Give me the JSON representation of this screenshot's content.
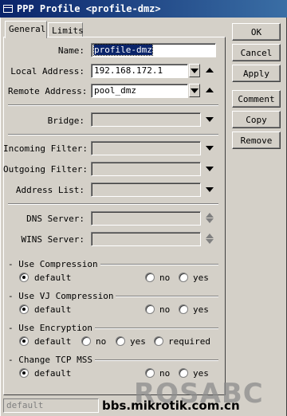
{
  "window": {
    "title": "PPP Profile <profile-dmz>"
  },
  "tabs": [
    {
      "label": "General"
    },
    {
      "label": "Limits"
    }
  ],
  "general": {
    "name": {
      "label": "Name:",
      "value": "profile-dmz"
    },
    "local_address": {
      "label": "Local Address:",
      "value": "192.168.172.1"
    },
    "remote_address": {
      "label": "Remote Address:",
      "value": "pool_dmz"
    },
    "bridge": {
      "label": "Bridge:",
      "value": ""
    },
    "incoming_filter": {
      "label": "Incoming Filter:",
      "value": ""
    },
    "outgoing_filter": {
      "label": "Outgoing Filter:",
      "value": ""
    },
    "address_list": {
      "label": "Address List:",
      "value": ""
    },
    "dns_server": {
      "label": "DNS Server:",
      "value": ""
    },
    "wins_server": {
      "label": "WINS Server:",
      "value": ""
    },
    "use_compression": {
      "label": "Use Compression",
      "options": [
        "default",
        "no",
        "yes"
      ],
      "selected": "default"
    },
    "use_vj_compression": {
      "label": "Use VJ Compression",
      "options": [
        "default",
        "no",
        "yes"
      ],
      "selected": "default"
    },
    "use_encryption": {
      "label": "Use Encryption",
      "options": [
        "default",
        "no",
        "yes",
        "required"
      ],
      "selected": "default"
    },
    "change_tcp_mss": {
      "label": "Change TCP MSS",
      "options": [
        "default",
        "no",
        "yes"
      ],
      "selected": "default"
    }
  },
  "buttons": {
    "ok": "OK",
    "cancel": "Cancel",
    "apply": "Apply",
    "comment": "Comment",
    "copy": "Copy",
    "remove": "Remove"
  },
  "status": {
    "text": "default"
  },
  "watermark": {
    "brand": "ROSABC",
    "site": "bbs.mikrotik.com.cn"
  }
}
